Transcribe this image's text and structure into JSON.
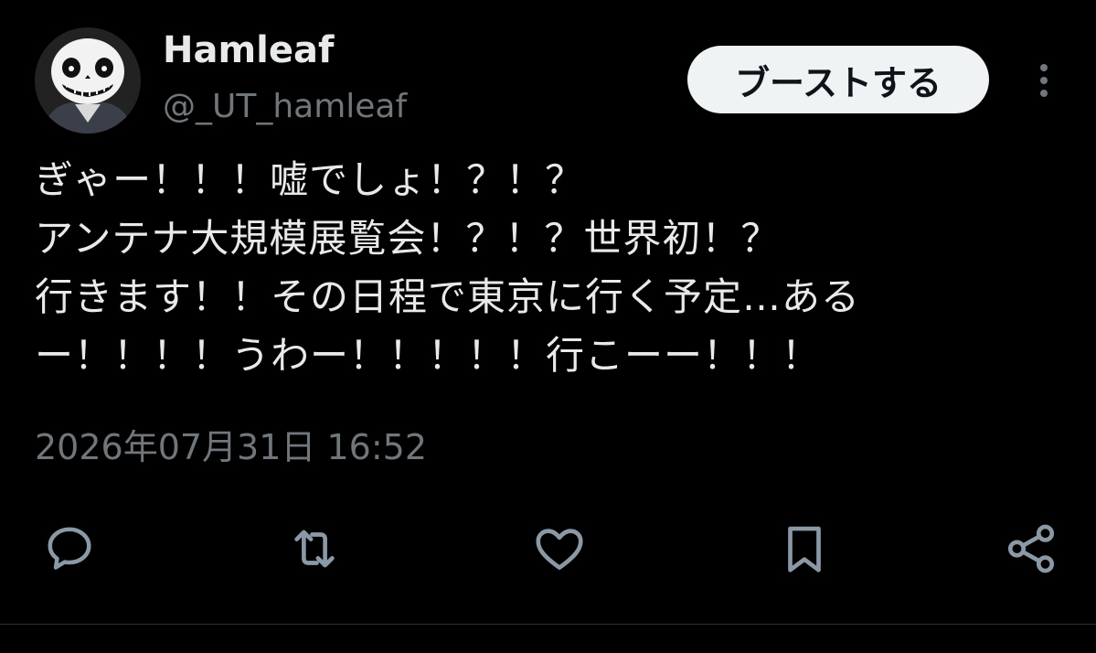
{
  "author": {
    "name": "Hamleaf",
    "handle": "@_UT_hamleaf"
  },
  "header": {
    "boost_label": "ブーストする",
    "more_icon": "vertical-ellipsis-icon"
  },
  "tweet": {
    "lines": [
      "ぎゃー！！！嘘でしょ！？！？",
      "アンテナ大規模展覧会！？！？世界初！？",
      "行きます！！その日程で東京に行く予定…ある",
      "ー！！！！うわー！！！！！行こーー！！！"
    ],
    "timestamp": "2026年07月31日 16:52"
  },
  "actions": [
    {
      "icon": "reply-icon"
    },
    {
      "icon": "retweet-icon"
    },
    {
      "icon": "like-icon"
    },
    {
      "icon": "bookmark-icon"
    },
    {
      "icon": "share-icon"
    }
  ],
  "colors": {
    "background": "#000000",
    "text_primary": "#e7e9ea",
    "text_secondary": "#71767b",
    "button_bg": "#eff3f4",
    "icon": "#8b98a5"
  }
}
